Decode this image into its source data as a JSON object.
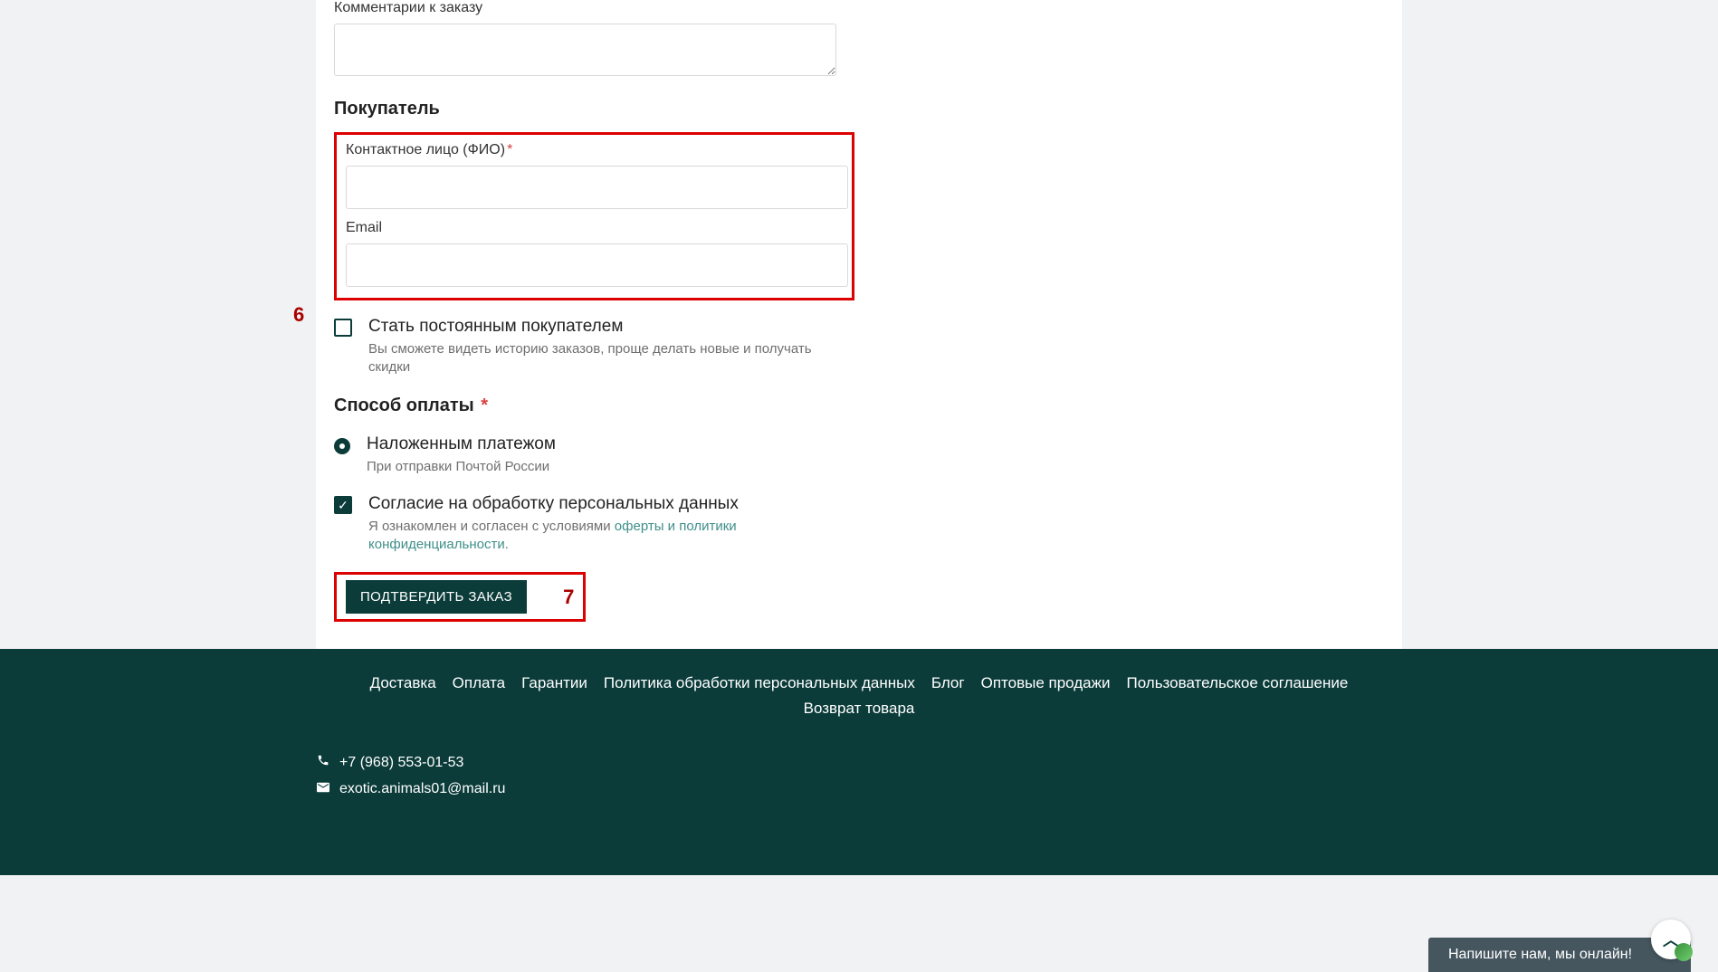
{
  "form": {
    "comments_label": "Комментарии к заказу",
    "buyer_heading": "Покупатель",
    "contact_label": "Контактное лицо (ФИО)",
    "email_label": "Email",
    "become_regular_title": "Стать постоянным покупателем",
    "become_regular_desc": "Вы сможете видеть историю заказов, проще делать новые и получать скидки",
    "payment_heading": "Способ оплаты",
    "payment_option_title": "Наложенным платежом",
    "payment_option_desc": "При отправки Почтой России",
    "consent_title": "Согласие на обработку персональных данных",
    "consent_prefix": "Я ознакомлен и согласен с условиями ",
    "consent_link": "оферты и политики конфиденциальности",
    "consent_suffix": ".",
    "submit_label": "ПОДТВЕРДИТЬ ЗАКАЗ"
  },
  "annotations": {
    "num6": "6",
    "num7": "7"
  },
  "footer": {
    "links": [
      "Доставка",
      "Оплата",
      "Гарантии",
      "Политика обработки персональных данных",
      "Блог",
      "Оптовые продажи",
      "Пользовательское соглашение",
      "Возврат товара"
    ],
    "phone": "+7 (968) 553-01-53",
    "email": "exotic.animals01@mail.ru"
  },
  "chat": {
    "label": "Напишите нам, мы онлайн!"
  }
}
